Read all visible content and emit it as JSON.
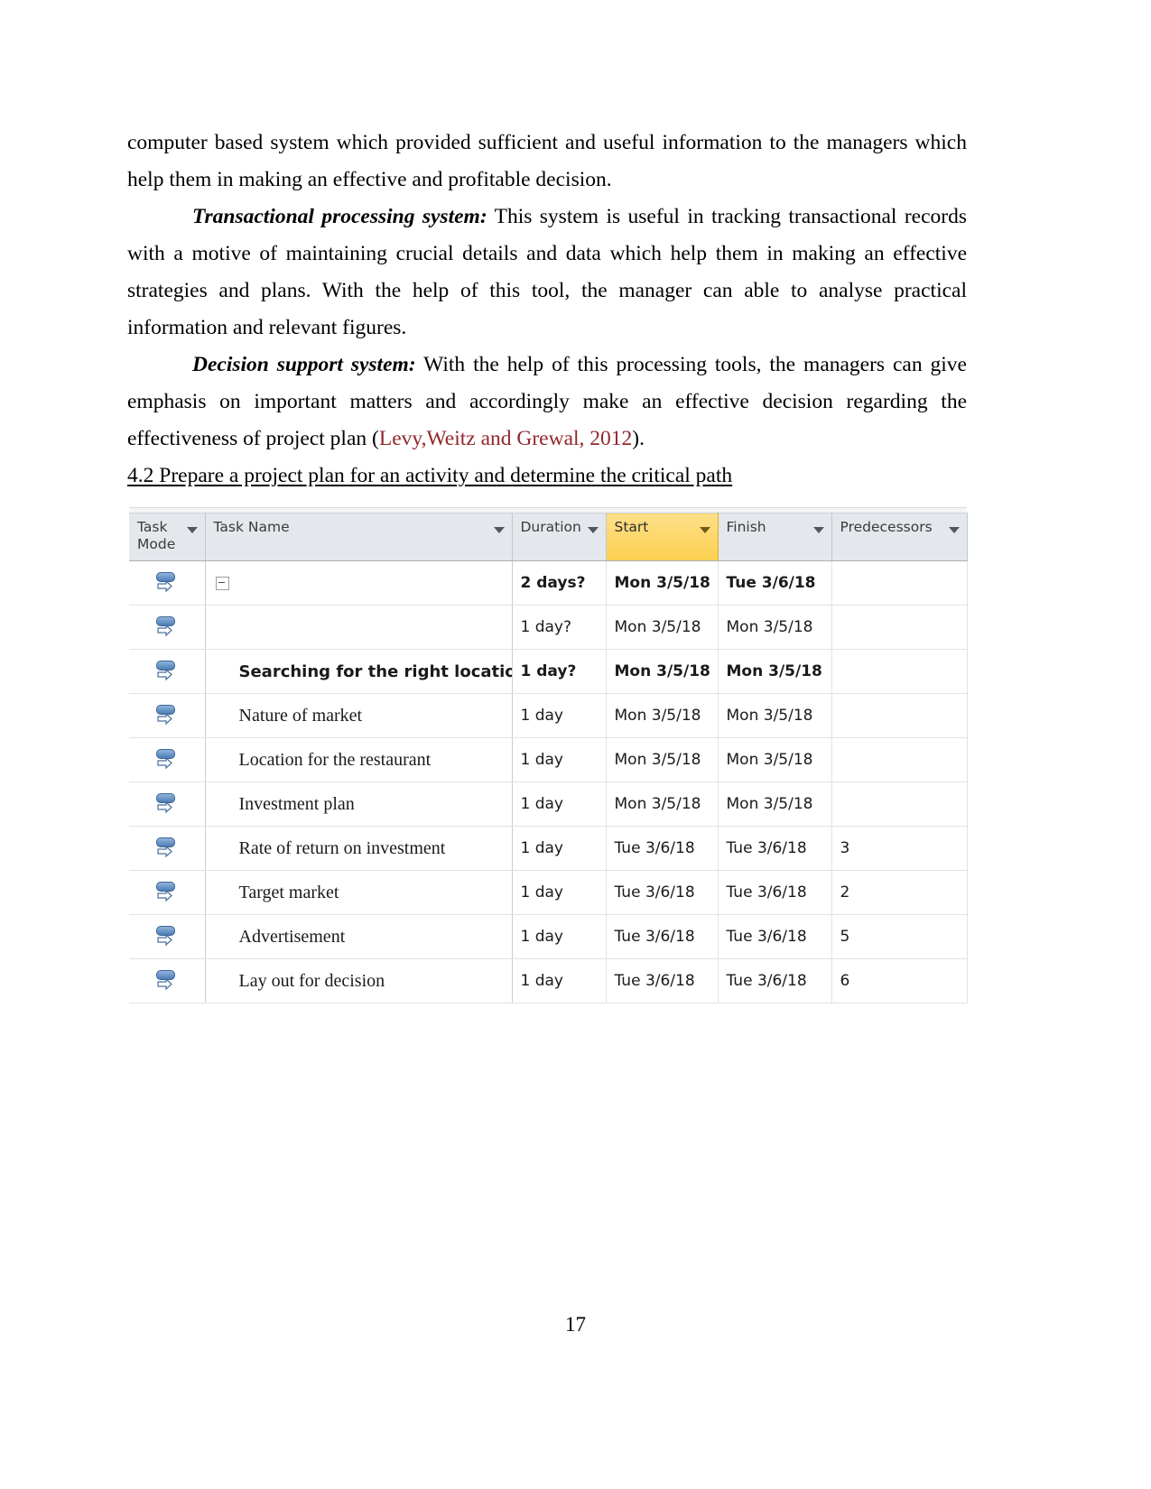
{
  "document": {
    "paragraphs": [
      {
        "id": "p1",
        "indent": false,
        "lead": "",
        "text": "computer based system which provided sufficient and useful information to the managers which help them in making an effective and profitable decision."
      },
      {
        "id": "p2",
        "indent": true,
        "lead": "Transactional processing system:",
        "text": " This system is useful in tracking transactional records with a motive of maintaining crucial details and data which help them in making an effective strategies and plans. With the help of this tool, the manager can able to analyse practical information and relevant figures."
      },
      {
        "id": "p3",
        "indent": true,
        "lead": "Decision support system:",
        "text": " With the help of this processing tools, the managers can give emphasis on important matters and accordingly make an effective decision regarding the effectiveness of project plan (",
        "citation": "Levy,Weitz and Grewal, 2012",
        "text_after": ")."
      }
    ],
    "subheading": "4.2 Prepare a project plan for an activity and determine the critical path",
    "page_number": "17",
    "citation_color": "#92262b"
  },
  "project_table": {
    "columns": [
      {
        "key": "mode",
        "label": "Task\nMode",
        "highlight": false
      },
      {
        "key": "name",
        "label": "Task Name",
        "highlight": false
      },
      {
        "key": "dur",
        "label": "Duration",
        "highlight": false
      },
      {
        "key": "start",
        "label": "Start",
        "highlight": true
      },
      {
        "key": "finish",
        "label": "Finish",
        "highlight": false
      },
      {
        "key": "pred",
        "label": "Predecessors",
        "highlight": false
      }
    ],
    "highlight_color": "#fbcf4f",
    "selection_color": "#dbe9f7",
    "rows": [
      {
        "mode_icon": "auto-scheduled-icon",
        "collapse": true,
        "name": "",
        "bold": true,
        "duration": "2 days?",
        "start": "Mon 3/5/18",
        "finish": "Tue 3/6/18",
        "predecessors": "",
        "selected": true
      },
      {
        "mode_icon": "auto-scheduled-icon",
        "collapse": false,
        "name": "",
        "bold": false,
        "duration": "1 day?",
        "start": "Mon 3/5/18",
        "finish": "Mon 3/5/18",
        "predecessors": "",
        "selected": false
      },
      {
        "mode_icon": "auto-scheduled-icon",
        "collapse": false,
        "name": "Searching for the right location",
        "bold": true,
        "duration": "1 day?",
        "start": "Mon 3/5/18",
        "finish": "Mon 3/5/18",
        "predecessors": "",
        "selected": false
      },
      {
        "mode_icon": "auto-scheduled-icon",
        "collapse": false,
        "name": "Nature of market",
        "bold": false,
        "duration": "1 day",
        "start": "Mon 3/5/18",
        "finish": "Mon 3/5/18",
        "predecessors": "",
        "selected": false
      },
      {
        "mode_icon": "auto-scheduled-icon",
        "collapse": false,
        "name": "Location for the restaurant",
        "bold": false,
        "duration": "1 day",
        "start": "Mon 3/5/18",
        "finish": "Mon 3/5/18",
        "predecessors": "",
        "selected": false
      },
      {
        "mode_icon": "auto-scheduled-icon",
        "collapse": false,
        "name": "Investment plan",
        "bold": false,
        "duration": "1 day",
        "start": "Mon 3/5/18",
        "finish": "Mon 3/5/18",
        "predecessors": "",
        "selected": false
      },
      {
        "mode_icon": "auto-scheduled-icon",
        "collapse": false,
        "name": "Rate of return on investment",
        "bold": false,
        "duration": "1 day",
        "start": "Tue 3/6/18",
        "finish": "Tue 3/6/18",
        "predecessors": "3",
        "selected": false
      },
      {
        "mode_icon": "auto-scheduled-icon",
        "collapse": false,
        "name": "Target market",
        "bold": false,
        "duration": "1 day",
        "start": "Tue 3/6/18",
        "finish": "Tue 3/6/18",
        "predecessors": "2",
        "selected": false
      },
      {
        "mode_icon": "auto-scheduled-icon",
        "collapse": false,
        "name": "Advertisement",
        "bold": false,
        "duration": "1 day",
        "start": "Tue 3/6/18",
        "finish": "Tue 3/6/18",
        "predecessors": "5",
        "selected": true
      },
      {
        "mode_icon": "auto-scheduled-icon",
        "collapse": false,
        "name": "Lay out for decision",
        "bold": false,
        "duration": "1 day",
        "start": "Tue 3/6/18",
        "finish": "Tue 3/6/18",
        "predecessors": "6",
        "selected": true
      }
    ]
  }
}
